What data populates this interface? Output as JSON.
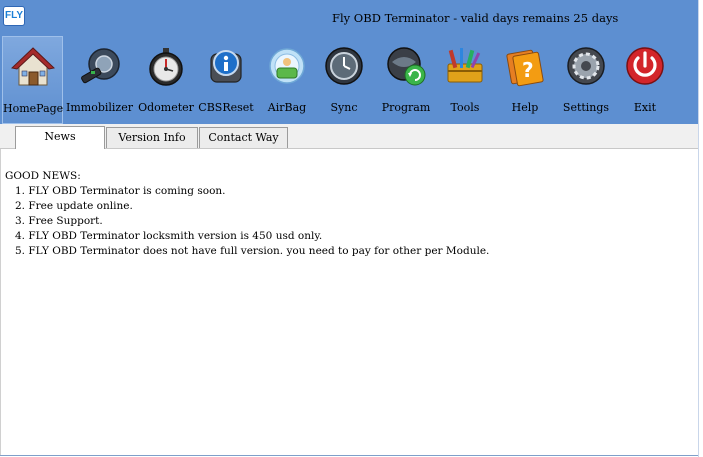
{
  "app": {
    "logo_text": "FLY",
    "title": "Fly OBD Terminator - valid days remains 25 days"
  },
  "toolbar": [
    {
      "label": "HomePage",
      "icon": "home-icon"
    },
    {
      "label": "Immobilizer",
      "icon": "key-icon"
    },
    {
      "label": "Odometer",
      "icon": "stopwatch-icon"
    },
    {
      "label": "CBSReset",
      "icon": "info-icon"
    },
    {
      "label": "AirBag",
      "icon": "airbag-icon"
    },
    {
      "label": "Sync",
      "icon": "clock-sync-icon"
    },
    {
      "label": "Program",
      "icon": "globe-refresh-icon"
    },
    {
      "label": "Tools",
      "icon": "toolbox-icon"
    },
    {
      "label": "Help",
      "icon": "help-book-icon"
    },
    {
      "label": "Settings",
      "icon": "gear-icon"
    },
    {
      "label": "Exit",
      "icon": "power-icon"
    }
  ],
  "tabs": [
    {
      "label": "News"
    },
    {
      "label": "Version Info"
    },
    {
      "label": "Contact Way"
    }
  ],
  "news": {
    "heading": "GOOD NEWS:",
    "items": [
      "1. FLY OBD Terminator is coming soon.",
      "2. Free update online.",
      "3. Free Support.",
      "4. FLY OBD Terminator locksmith version is 450 usd only.",
      "5. FLY OBD Terminator does not have full version. you need to pay for other per Module."
    ]
  }
}
